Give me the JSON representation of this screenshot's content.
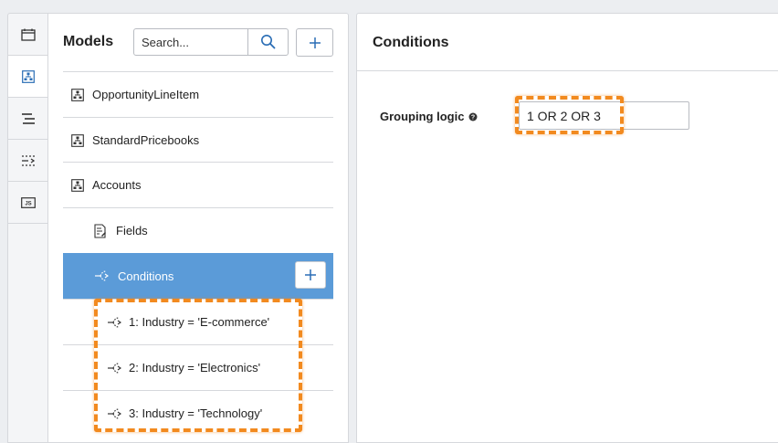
{
  "rail": {
    "items": [
      {
        "icon": "calendar-icon",
        "active": false
      },
      {
        "icon": "model-icon",
        "active": true
      },
      {
        "icon": "list-icon",
        "active": false
      },
      {
        "icon": "condition-list-icon",
        "active": false
      },
      {
        "icon": "js-icon",
        "active": false,
        "text": "JS"
      }
    ]
  },
  "models": {
    "title": "Models",
    "search_placeholder": "Search...",
    "tree": [
      {
        "label": "OpportunityLineItem",
        "icon": "model-icon",
        "level": 0
      },
      {
        "label": "StandardPricebooks",
        "icon": "model-icon",
        "level": 0
      },
      {
        "label": "Accounts",
        "icon": "model-icon",
        "level": 0
      },
      {
        "label": "Fields",
        "icon": "fields-icon",
        "level": 1
      },
      {
        "label": "Conditions",
        "icon": "condition-icon",
        "level": 1,
        "selected": true
      },
      {
        "label": "1: Industry = 'E-commerce'",
        "icon": "condition-icon",
        "level": 2
      },
      {
        "label": "2: Industry = 'Electronics'",
        "icon": "condition-icon",
        "level": 2
      },
      {
        "label": "3: Industry = 'Technology'",
        "icon": "condition-icon",
        "level": 2
      }
    ]
  },
  "conditions": {
    "title": "Conditions",
    "grouping_label": "Grouping logic",
    "grouping_value": "1 OR 2 OR 3"
  },
  "colors": {
    "selected_bg": "#5b9bd8",
    "highlight": "#f28a1f",
    "accent_icon": "#2a6db5"
  }
}
